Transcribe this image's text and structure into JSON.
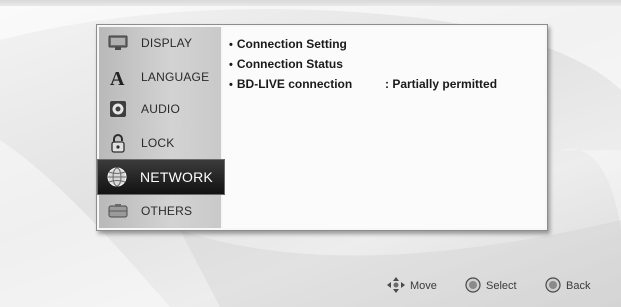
{
  "menu": {
    "items": [
      {
        "label": "DISPLAY",
        "icon": "display-icon"
      },
      {
        "label": "LANGUAGE",
        "icon": "language-icon"
      },
      {
        "label": "AUDIO",
        "icon": "audio-icon"
      },
      {
        "label": "LOCK",
        "icon": "lock-icon"
      },
      {
        "label": "NETWORK",
        "icon": "network-icon",
        "selected": true
      },
      {
        "label": "OTHERS",
        "icon": "others-icon"
      }
    ]
  },
  "content": {
    "options": [
      {
        "bullet": "•",
        "label": "Connection Setting"
      },
      {
        "bullet": "•",
        "label": "Connection Status"
      },
      {
        "bullet": "•",
        "label": "BD-LIVE connection",
        "value": ": Partially permitted"
      }
    ]
  },
  "footer": {
    "move": "Move",
    "select": "Select",
    "back": "Back"
  }
}
